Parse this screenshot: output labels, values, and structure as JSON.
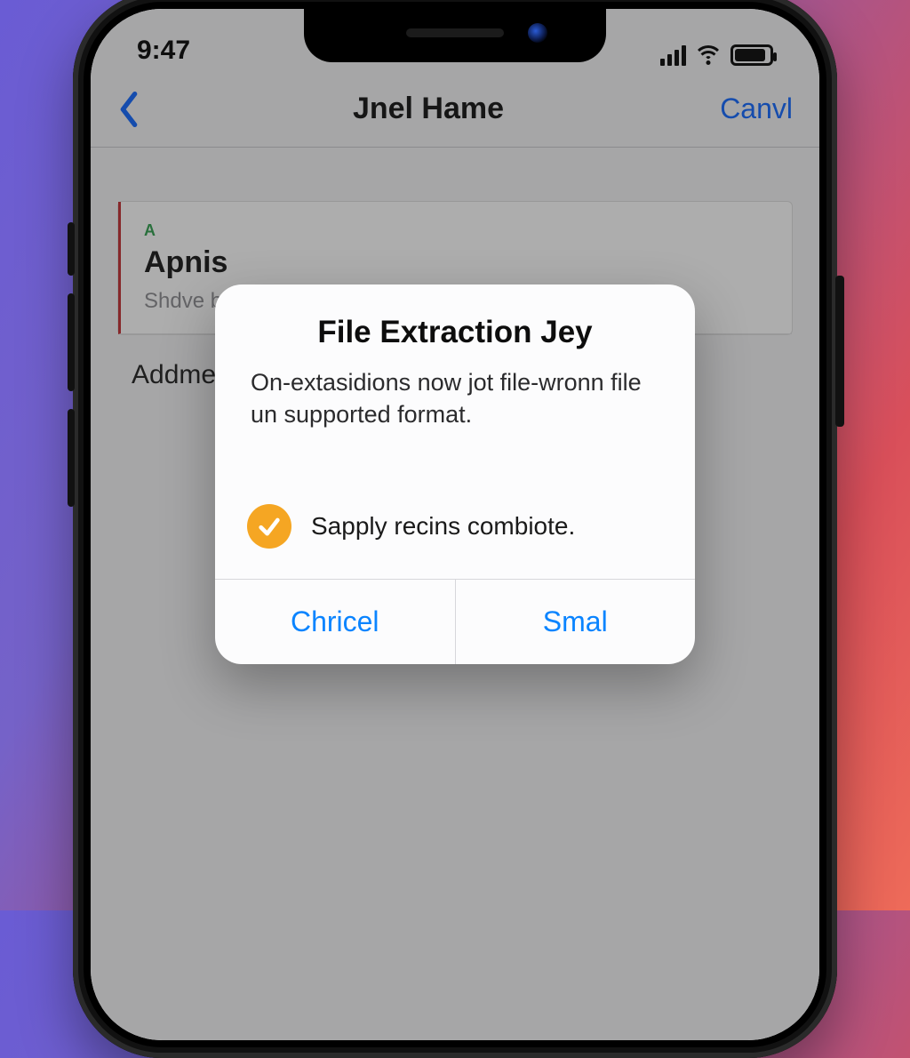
{
  "statusbar": {
    "time": "9:47"
  },
  "navbar": {
    "title": "Jnel Hame",
    "action": "Canvl"
  },
  "background": {
    "card": {
      "tag": "A",
      "title": "Apnis",
      "subtitle": "Shdve b"
    },
    "row_label": "Addmedi"
  },
  "alert": {
    "title": "File Extraction Jey",
    "message": "On-extasidions now jot file-wronn file un supported format.",
    "status_text": "Sapply recins combiote.",
    "buttons": {
      "primary": "Chricel",
      "secondary": "Smal"
    }
  }
}
